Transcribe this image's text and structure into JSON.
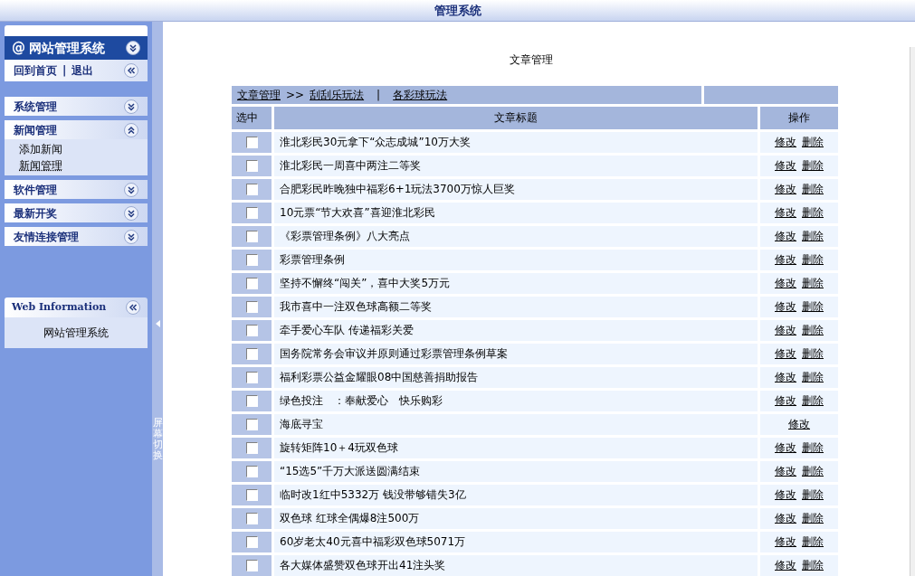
{
  "header": {
    "title": "管理系统"
  },
  "sidebar": {
    "brand": "网站管理系统",
    "brand_symbol": "@",
    "links": [
      {
        "label": "回到首页"
      },
      {
        "label": "退出"
      }
    ],
    "separator": "|",
    "groups": [
      {
        "label": "系统管理",
        "expanded": false
      },
      {
        "label": "新闻管理",
        "expanded": true,
        "items": [
          {
            "label": "添加新闻",
            "selected": false
          },
          {
            "label": "新闻管理",
            "selected": true
          }
        ]
      },
      {
        "label": "软件管理",
        "expanded": false
      },
      {
        "label": "最新开奖",
        "expanded": false
      },
      {
        "label": "友情连接管理",
        "expanded": false
      }
    ],
    "info": {
      "title": "Web Information",
      "text": "网站管理系统"
    }
  },
  "splitter": {
    "label": "屏幕切换"
  },
  "page_title": "文章管理",
  "breadcrumb": {
    "root": "文章管理",
    "arrow": ">>",
    "links": [
      "刮刮乐玩法",
      "各彩球玩法"
    ],
    "separator": "|"
  },
  "table": {
    "columns": [
      "选中",
      "文章标题",
      "操作"
    ],
    "rows": [
      {
        "title": "淮北彩民30元拿下“众志成城”10万大奖",
        "checked": false,
        "actions": [
          "修改",
          "删除"
        ]
      },
      {
        "title": "淮北彩民一周喜中两注二等奖",
        "checked": false,
        "actions": [
          "修改",
          "删除"
        ]
      },
      {
        "title": "合肥彩民昨晚独中福彩6+1玩法3700万惊人巨奖",
        "checked": false,
        "actions": [
          "修改",
          "删除"
        ]
      },
      {
        "title": "10元票“节大欢喜”喜迎淮北彩民",
        "checked": false,
        "actions": [
          "修改",
          "删除"
        ]
      },
      {
        "title": "《彩票管理条例》八大亮点",
        "checked": false,
        "actions": [
          "修改",
          "删除"
        ]
      },
      {
        "title": "彩票管理条例",
        "checked": false,
        "actions": [
          "修改",
          "删除"
        ]
      },
      {
        "title": "坚持不懈终“闯关”，喜中大奖5万元",
        "checked": false,
        "actions": [
          "修改",
          "删除"
        ]
      },
      {
        "title": "我市喜中一注双色球高额二等奖",
        "checked": false,
        "actions": [
          "修改",
          "删除"
        ]
      },
      {
        "title": "牵手爱心车队 传递福彩关爱",
        "checked": false,
        "actions": [
          "修改",
          "删除"
        ]
      },
      {
        "title": "国务院常务会审议并原则通过彩票管理条例草案",
        "checked": false,
        "actions": [
          "修改",
          "删除"
        ]
      },
      {
        "title": "福利彩票公益金耀眼08中国慈善捐助报告",
        "checked": false,
        "actions": [
          "修改",
          "删除"
        ]
      },
      {
        "title": "绿色投注　：奉献爱心　快乐购彩",
        "checked": false,
        "actions": [
          "修改",
          "删除"
        ]
      },
      {
        "title": "海底寻宝",
        "checked": false,
        "actions": [
          "修改"
        ]
      },
      {
        "title": "旋转矩阵10＋4玩双色球",
        "checked": false,
        "actions": [
          "修改",
          "删除"
        ]
      },
      {
        "title": "“15选5”千万大派送圆满结束",
        "checked": false,
        "actions": [
          "修改",
          "删除"
        ]
      },
      {
        "title": "临时改1红中5332万 钱没带够错失3亿",
        "checked": false,
        "actions": [
          "修改",
          "删除"
        ]
      },
      {
        "title": "双色球 红球全偶爆8注500万",
        "checked": false,
        "actions": [
          "修改",
          "删除"
        ]
      },
      {
        "title": "60岁老太40元喜中福彩双色球5071万",
        "checked": false,
        "actions": [
          "修改",
          "删除"
        ]
      },
      {
        "title": "各大媒体盛赞双色球开出41注头奖",
        "checked": false,
        "actions": [
          "修改",
          "删除"
        ]
      }
    ]
  }
}
